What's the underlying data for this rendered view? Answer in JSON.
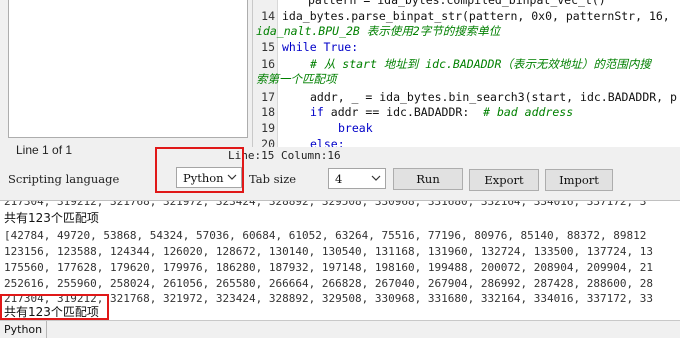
{
  "left_panel": {
    "status": "Line 1 of 1"
  },
  "editor": {
    "lines": [
      {
        "num": "",
        "text": "pattern = ida_bytes.compiled_binpat_vec_t()",
        "indent": 0,
        "type": "normal"
      },
      {
        "num": "14",
        "text": "ida_bytes.parse_binpat_str(pattern, 0x0, patternStr, 16,",
        "indent": 2,
        "type": "normal"
      },
      {
        "num": "",
        "text": "ida_nalt.BPU_2B 表示使用2字节的搜索单位",
        "indent": 0,
        "type": "comment-wrap"
      },
      {
        "num": "15",
        "text_kw": "while True:",
        "indent": 2,
        "type": "keyword"
      },
      {
        "num": "16",
        "text": "# 从 start 地址到 idc.BADADDR（表示无效地址）的范围内搜",
        "indent": 4,
        "type": "comment"
      },
      {
        "num": "",
        "text": "索第一个匹配项",
        "indent": 0,
        "type": "comment-wrap"
      },
      {
        "num": "17",
        "text": "addr, _ = ida_bytes.bin_search3(start, idc.BADADDR, p",
        "indent": 4,
        "type": "normal"
      },
      {
        "num": "18",
        "text_kw": "if",
        "text": " addr == idc.BADADDR:  ",
        "text_cm": "# bad address",
        "indent": 4,
        "type": "mixed"
      },
      {
        "num": "19",
        "text_kw": "break",
        "indent": 6,
        "type": "keyword"
      },
      {
        "num": "20",
        "text_kw": "else:",
        "indent": 4,
        "type": "keyword"
      }
    ]
  },
  "status": {
    "position": "Line:15 Column:16"
  },
  "controls": {
    "scripting_language_label": "Scripting language",
    "scripting_language_value": "Python",
    "tab_size_label": "Tab size",
    "tab_size_value": "4",
    "run_label": "Run",
    "export_label": "Export",
    "import_label": "Import"
  },
  "output": {
    "lines": [
      "217304, 319212, 321768, 321972, 323424, 328892, 329508, 330968, 331680, 332164, 334016, 337172, 3",
      "共有123个匹配项",
      "[42784, 49720, 53868, 54324, 57036, 60684, 61052, 63264, 75516, 77196, 80976, 85140, 88372, 89812",
      "123156, 123588, 124344, 126020, 128672, 130140, 130540, 131168, 131960, 132724, 133500, 137724, 13",
      "175560, 177628, 179620, 179976, 186280, 187932, 197148, 198160, 199488, 200072, 208904, 209904, 21",
      "252616, 255960, 258024, 261056, 265580, 266664, 266828, 267040, 267904, 286992, 287428, 288600, 28",
      "217304, 319212, 321768, 321972, 323424, 328892, 329508, 330968, 331680, 332164, 334016, 337172, 33",
      "共有123个匹配项"
    ]
  },
  "bottom": {
    "label": "Python"
  },
  "colors": {
    "highlight": "#e01818",
    "keyword": "#0000c8",
    "comment": "#008000"
  }
}
